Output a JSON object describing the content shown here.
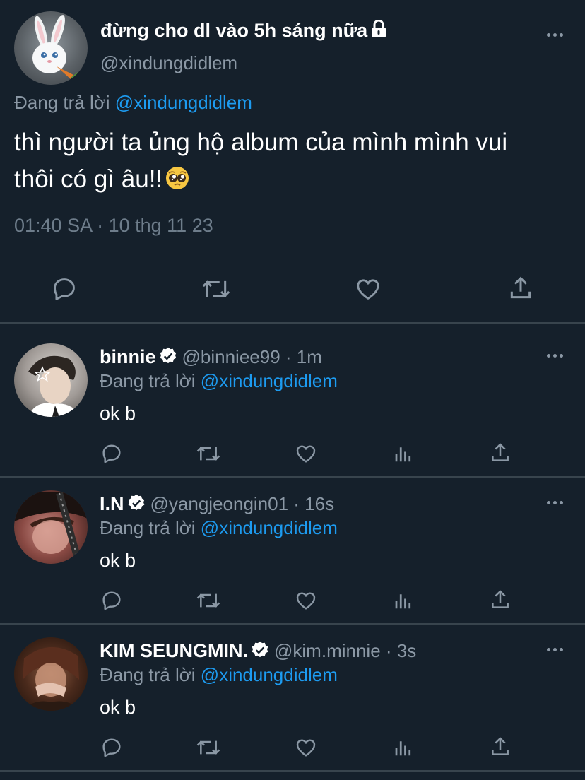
{
  "main_tweet": {
    "display_name": "đừng cho dl vào 5h sáng nữa",
    "handle": "@xindungdidlem",
    "reply_prefix": "Đang trả lời",
    "reply_to": "@xindungdidlem",
    "text_line1": "thì người ta ủng hộ album của mình mình vui",
    "text_line2": "thôi có gì âu!!",
    "timestamp": "01:40 SA · 10 thg 11 23",
    "icons": [
      "reply-icon",
      "retweet-icon",
      "like-icon",
      "share-icon"
    ]
  },
  "replies": [
    {
      "display_name": "binnie",
      "handle": "@binniee99 · 1m",
      "reply_prefix": "Đang trả lời",
      "reply_to": "@xindungdidlem",
      "text": "ok b"
    },
    {
      "display_name": "I.N",
      "handle": "@yangjeongin01 · 16s",
      "reply_prefix": "Đang trả lời",
      "reply_to": "@xindungdidlem",
      "text": "ok b"
    },
    {
      "display_name": "KIM SEUNGMIN.",
      "handle": "@kim.minnie · 3s",
      "reply_prefix": "Đang trả lời",
      "reply_to": "@xindungdidlem",
      "text": "ok b"
    }
  ],
  "colors": {
    "background": "#15202b",
    "text_primary": "#ffffff",
    "text_secondary": "#8b98a5",
    "accent": "#1d9bf0",
    "divider": "#38444d"
  }
}
